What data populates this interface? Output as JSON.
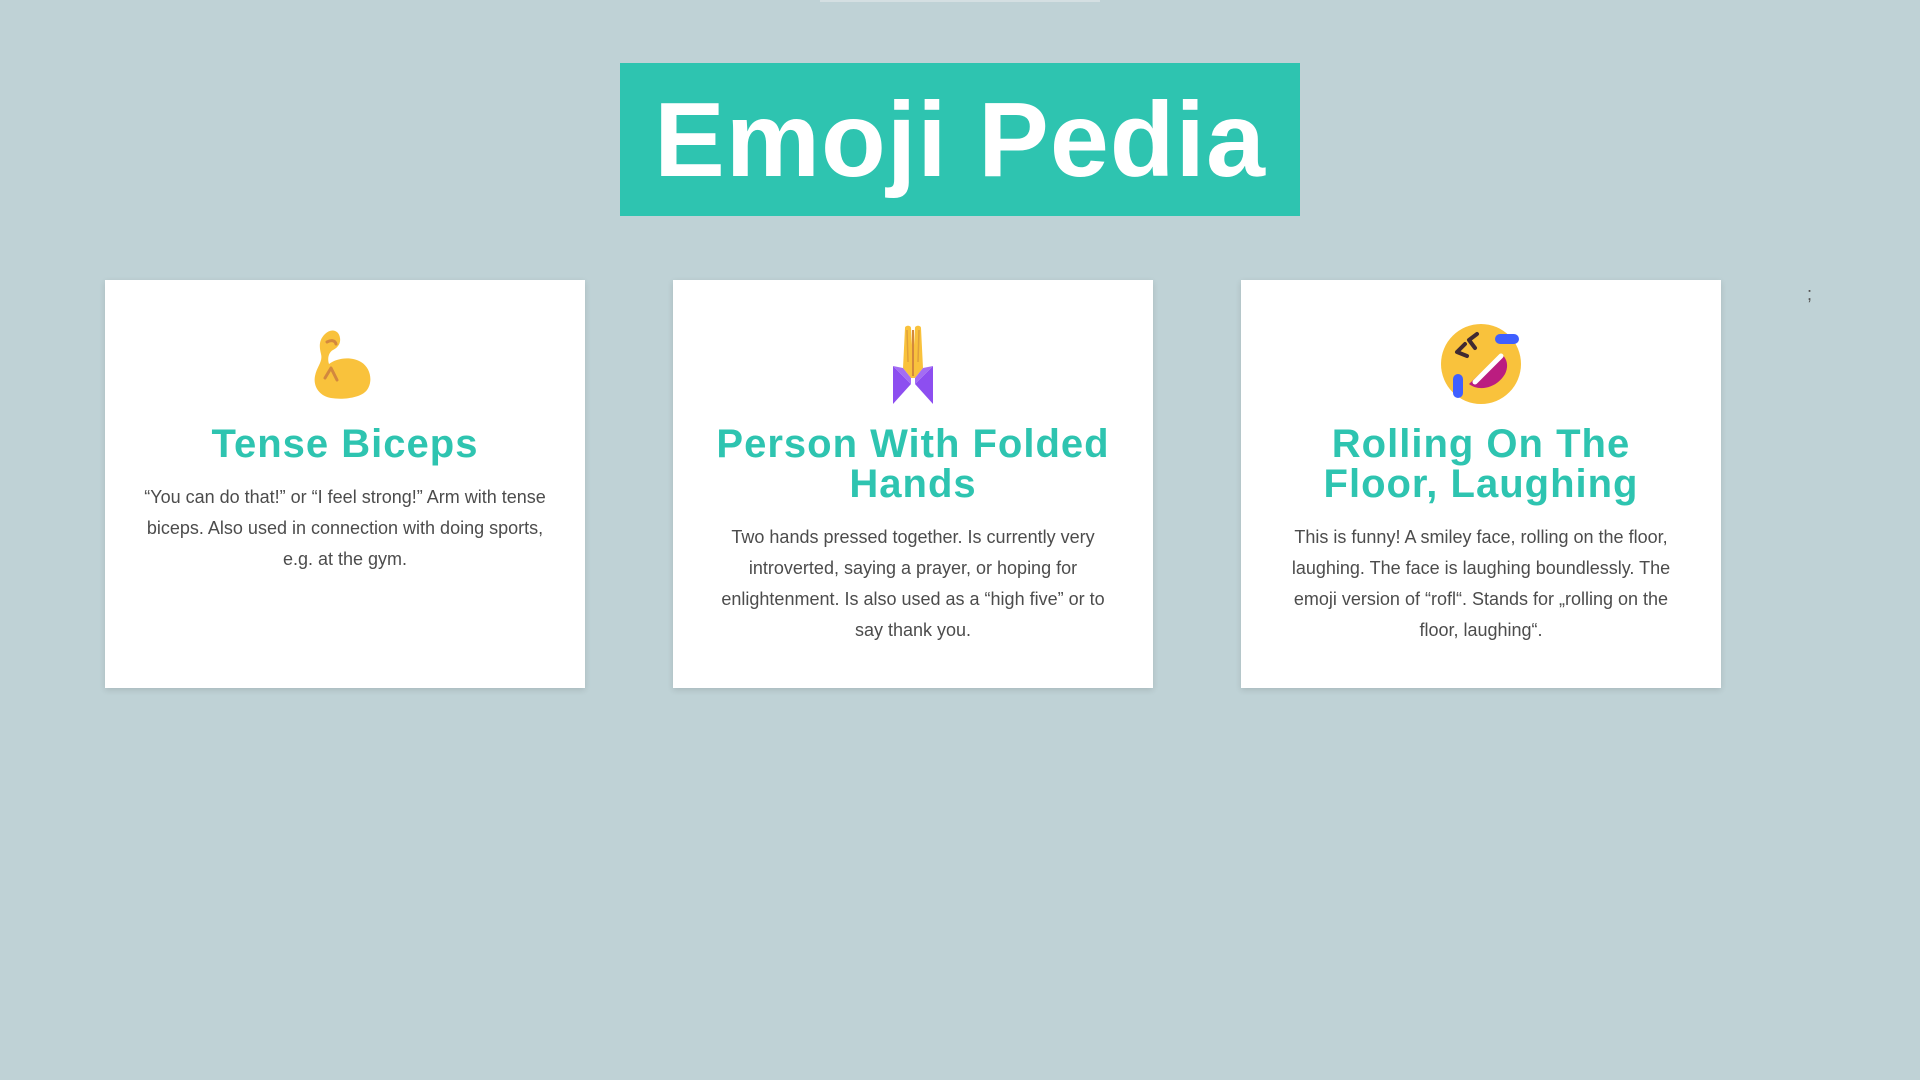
{
  "header": {
    "title": "Emoji Pedia"
  },
  "cards": [
    {
      "emoji_icon": "flexed-biceps-icon",
      "title": "Tense Biceps",
      "description": "“You can do that!” or “I feel strong!” Arm with tense biceps. Also used in connection with doing sports, e.g. at the gym."
    },
    {
      "emoji_icon": "folded-hands-icon",
      "title": "Person With Folded Hands",
      "description": "Two hands pressed together. Is currently very introverted, saying a prayer, or hoping for enlightenment. Is also used as a “high five” or to say thank you."
    },
    {
      "emoji_icon": "rolling-on-floor-laughing-icon",
      "title": "Rolling On The Floor, Laughing",
      "description": "This is funny! A smiley face, rolling on the floor, laughing. The face is laughing boundlessly. The emoji version of “rofl“. Stands for „rolling on the floor, laughing“."
    }
  ],
  "stray_text": ";",
  "colors": {
    "background": "#bfd2d6",
    "accent": "#2ec4b0",
    "card": "#ffffff",
    "body_text": "#4c4c4c"
  }
}
